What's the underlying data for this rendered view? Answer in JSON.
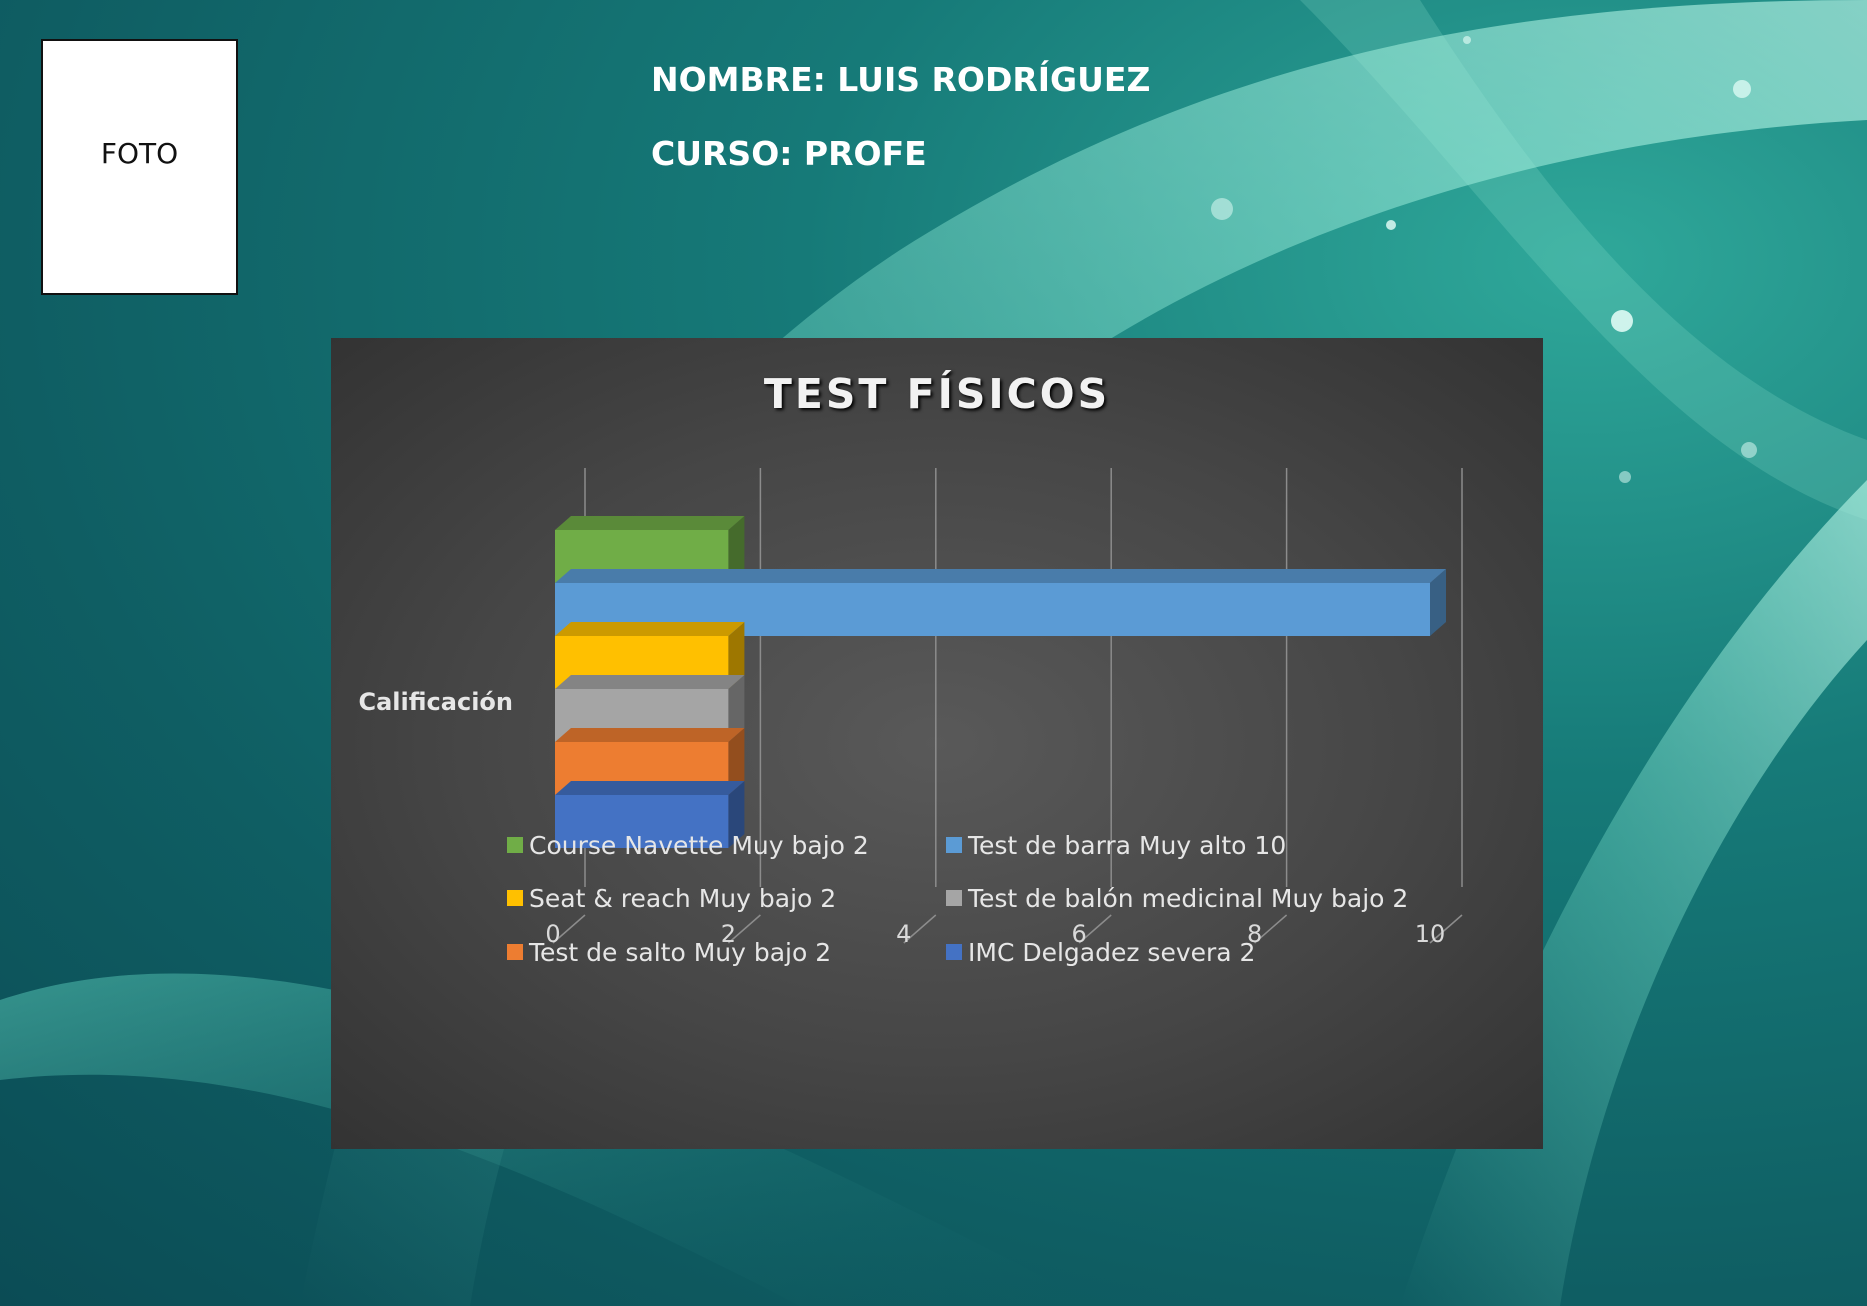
{
  "photo": {
    "label": "FOTO"
  },
  "header": {
    "name_line": "NOMBRE: LUIS RODRÍGUEZ",
    "course_line": "CURSO: PROFE"
  },
  "chart_data": {
    "type": "bar",
    "orientation": "horizontal",
    "style": "3d-clustered",
    "title": "TEST FÍSICOS",
    "categories": [
      "Calificación"
    ],
    "xlim": [
      0,
      10
    ],
    "x_ticks": [
      "0",
      "2",
      "4",
      "6",
      "8",
      "10"
    ],
    "grid": true,
    "legend_position": "bottom",
    "series": [
      {
        "name": "IMC Delgadez severa 2",
        "values": [
          2
        ],
        "color": "#4472c4"
      },
      {
        "name": "Test de salto Muy bajo 2",
        "values": [
          2
        ],
        "color": "#ed7d31"
      },
      {
        "name": "Test de balón medicinal Muy bajo 2",
        "values": [
          2
        ],
        "color": "#a5a5a5"
      },
      {
        "name": "Seat & reach Muy bajo 2",
        "values": [
          2
        ],
        "color": "#ffc000"
      },
      {
        "name": "Test de barra Muy alto 10",
        "values": [
          10
        ],
        "color": "#5b9bd5"
      },
      {
        "name": "Course Navette Muy bajo 2",
        "values": [
          2
        ],
        "color": "#70ad47"
      }
    ],
    "legend_order": [
      "Course Navette Muy bajo 2",
      "Test de barra Muy alto 10",
      "Seat & reach Muy bajo 2",
      "Test de balón medicinal Muy bajo 2",
      "Test de salto Muy bajo 2",
      "IMC Delgadez severa 2"
    ]
  }
}
